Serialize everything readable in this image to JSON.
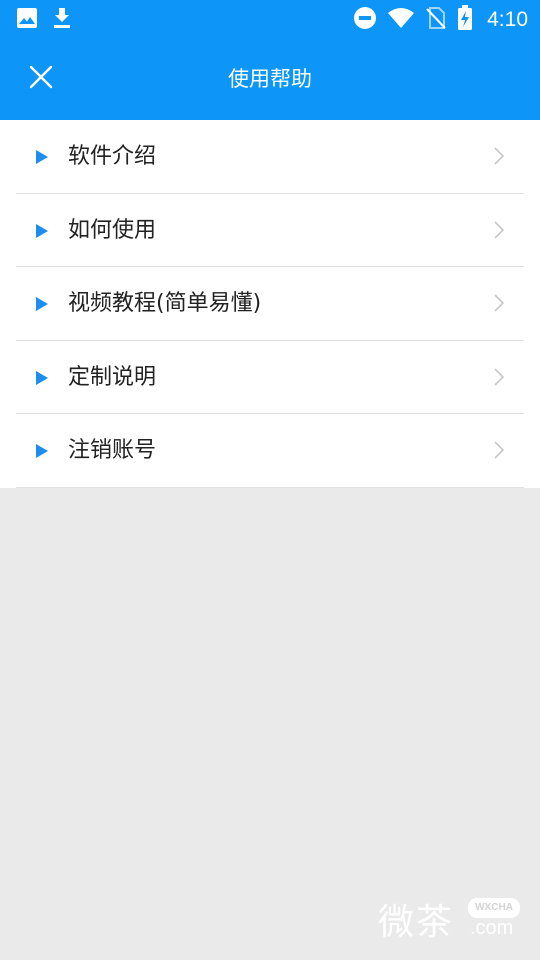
{
  "status_bar": {
    "time": "4:10",
    "left_icons": [
      "image-icon",
      "download-icon"
    ],
    "right_icons": [
      "do-not-disturb-icon",
      "wifi-icon",
      "no-sim-icon",
      "battery-charging-icon"
    ]
  },
  "toolbar": {
    "title": "使用帮助",
    "close_icon": "close-icon",
    "color": "#0d95f7"
  },
  "help_items": [
    {
      "label": "软件介绍"
    },
    {
      "label": "如何使用"
    },
    {
      "label": "视频教程(简单易懂)"
    },
    {
      "label": "定制说明"
    },
    {
      "label": "注销账号"
    }
  ],
  "watermark": {
    "text": "微茶",
    "badge": "WXCHA",
    "domain": ".com"
  },
  "colors": {
    "accent": "#0d95f7",
    "triangle": "#1e8df0",
    "background": "#eaeaea"
  }
}
